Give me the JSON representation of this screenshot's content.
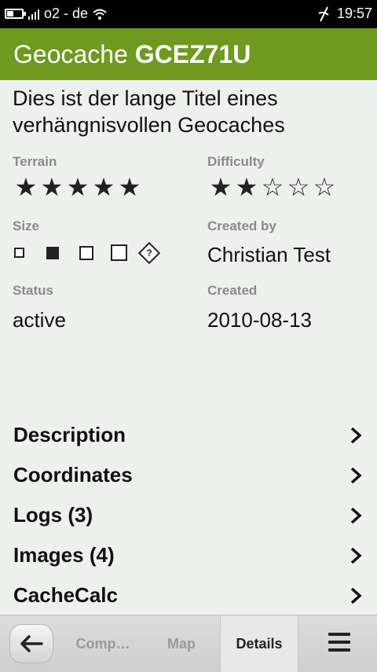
{
  "statusbar": {
    "carrier": "o2 - de",
    "time": "19:57"
  },
  "header": {
    "prefix": "Geocache",
    "code": "GCEZ71U"
  },
  "title": "Dies ist der lange Titel eines verhängnisvollen Geocaches",
  "details": {
    "terrain": {
      "label": "Terrain",
      "stars": [
        "★",
        "★",
        "★",
        "★",
        "★"
      ],
      "value": 5
    },
    "difficulty": {
      "label": "Difficulty",
      "stars": [
        "★",
        "★",
        "☆",
        "☆",
        "☆"
      ],
      "value": 2
    },
    "size": {
      "label": "Size"
    },
    "created_by": {
      "label": "Created by",
      "value": "Christian Test"
    },
    "status": {
      "label": "Status",
      "value": "active"
    },
    "created": {
      "label": "Created",
      "value": "2010-08-13"
    }
  },
  "menu": [
    {
      "label": "Description"
    },
    {
      "label": "Coordinates"
    },
    {
      "label": "Logs (3)"
    },
    {
      "label": "Images (4)"
    },
    {
      "label": "CacheCalc"
    }
  ],
  "toolbar": {
    "tabs": [
      "Comp…",
      "Map",
      "Details"
    ],
    "active_tab": "Details",
    "back_icon": "back-arrow-icon",
    "menu_icon": "hamburger-menu-icon"
  },
  "colors": {
    "header_bg": "#6e9a20",
    "background": "#eef0ee"
  }
}
